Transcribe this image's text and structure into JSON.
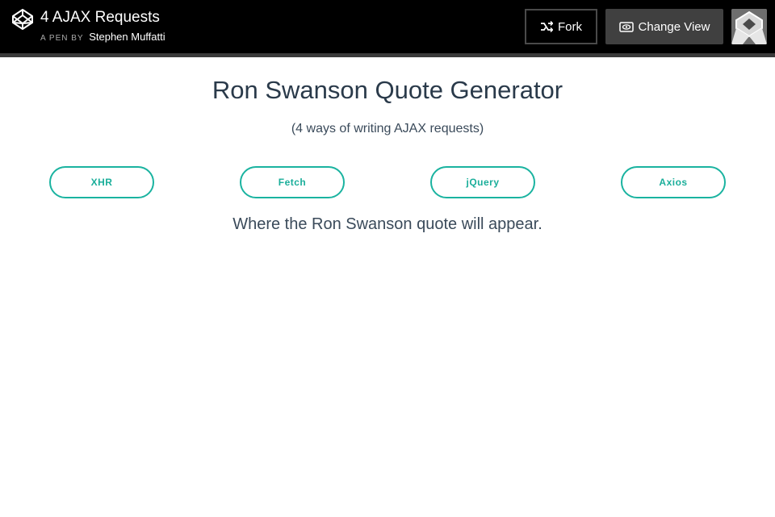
{
  "header": {
    "title": "4 AJAX Requests",
    "byline_prefix": "A PEN BY",
    "author": "Stephen Muffatti",
    "fork_label": "Fork",
    "change_view_label": "Change View"
  },
  "main": {
    "title": "Ron Swanson Quote Generator",
    "subtitle": "(4 ways of writing AJAX requests)",
    "buttons": [
      "XHR",
      "Fetch",
      "jQuery",
      "Axios"
    ],
    "quote_placeholder": "Where the Ron Swanson quote will appear."
  },
  "colors": {
    "topbar": "#000000",
    "accent": "#1ab3a0",
    "text": "#2a3a4a"
  },
  "icons": [
    "codepen-logo-icon",
    "fork-icon",
    "eye-icon",
    "codepen-avatar-icon"
  ]
}
